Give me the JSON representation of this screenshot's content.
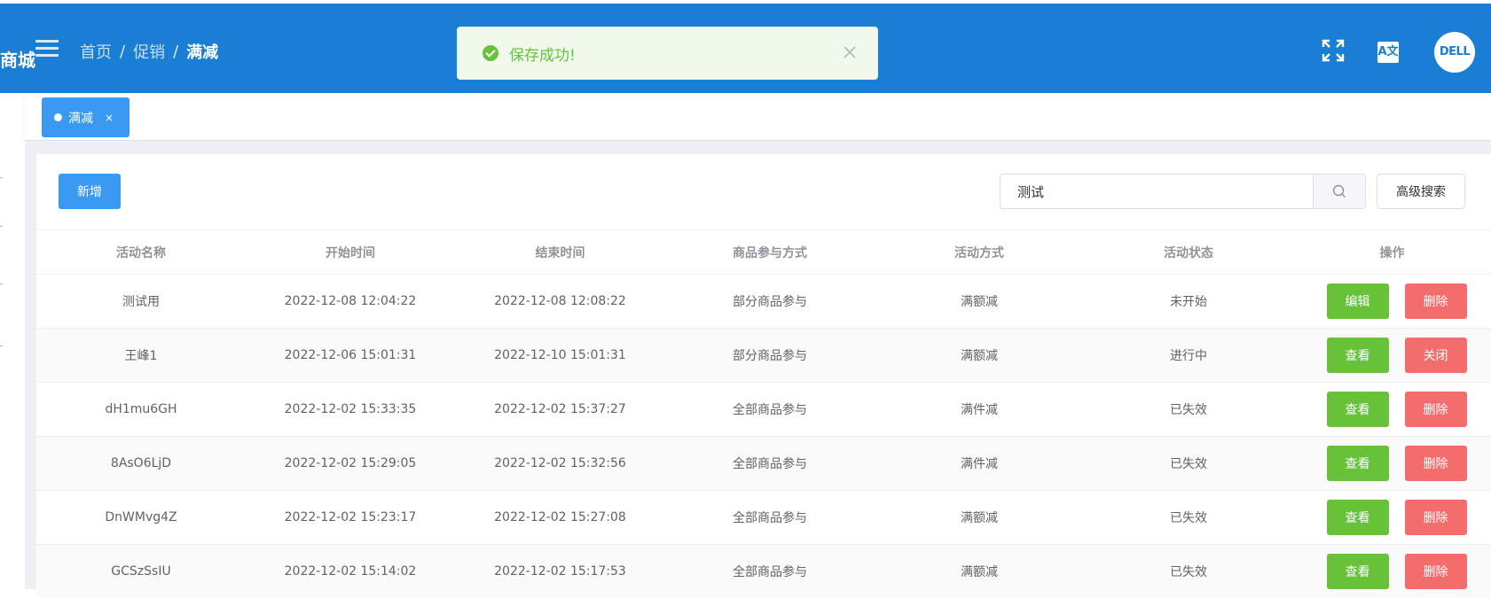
{
  "header": {
    "brand": "商城",
    "breadcrumb": [
      "首页",
      "促销",
      "满减"
    ],
    "avatar_text": "DELL",
    "translate_text": "A文"
  },
  "toast": {
    "message": "保存成功!"
  },
  "tags": [
    {
      "label": "满减"
    }
  ],
  "toolbar": {
    "add_label": "新增",
    "search_value": "测试",
    "advanced_label": "高级搜索"
  },
  "table": {
    "columns": [
      "活动名称",
      "开始时间",
      "结束时间",
      "商品参与方式",
      "活动方式",
      "活动状态",
      "操作"
    ],
    "rows": [
      {
        "name": "测试用",
        "start": "2022-12-08 12:04:22",
        "end": "2022-12-08 12:08:22",
        "participation": "部分商品参与",
        "method": "满额减",
        "status": "未开始",
        "action1": "编辑",
        "action2": "删除"
      },
      {
        "name": "王峰1",
        "start": "2022-12-06 15:01:31",
        "end": "2022-12-10 15:01:31",
        "participation": "部分商品参与",
        "method": "满额减",
        "status": "进行中",
        "action1": "查看",
        "action2": "关闭"
      },
      {
        "name": "dH1mu6GH",
        "start": "2022-12-02 15:33:35",
        "end": "2022-12-02 15:37:27",
        "participation": "全部商品参与",
        "method": "满件减",
        "status": "已失效",
        "action1": "查看",
        "action2": "删除"
      },
      {
        "name": "8AsO6LjD",
        "start": "2022-12-02 15:29:05",
        "end": "2022-12-02 15:32:56",
        "participation": "全部商品参与",
        "method": "满件减",
        "status": "已失效",
        "action1": "查看",
        "action2": "删除"
      },
      {
        "name": "DnWMvg4Z",
        "start": "2022-12-02 15:23:17",
        "end": "2022-12-02 15:27:08",
        "participation": "全部商品参与",
        "method": "满额减",
        "status": "已失效",
        "action1": "查看",
        "action2": "删除"
      },
      {
        "name": "GCSzSsIU",
        "start": "2022-12-02 15:14:02",
        "end": "2022-12-02 15:17:53",
        "participation": "全部商品参与",
        "method": "满额减",
        "status": "已失效",
        "action1": "查看",
        "action2": "删除"
      }
    ]
  },
  "colors": {
    "header_bg": "#1a7fd4",
    "primary": "#3a9af2",
    "success": "#67c23a",
    "danger": "#f56c6c"
  }
}
